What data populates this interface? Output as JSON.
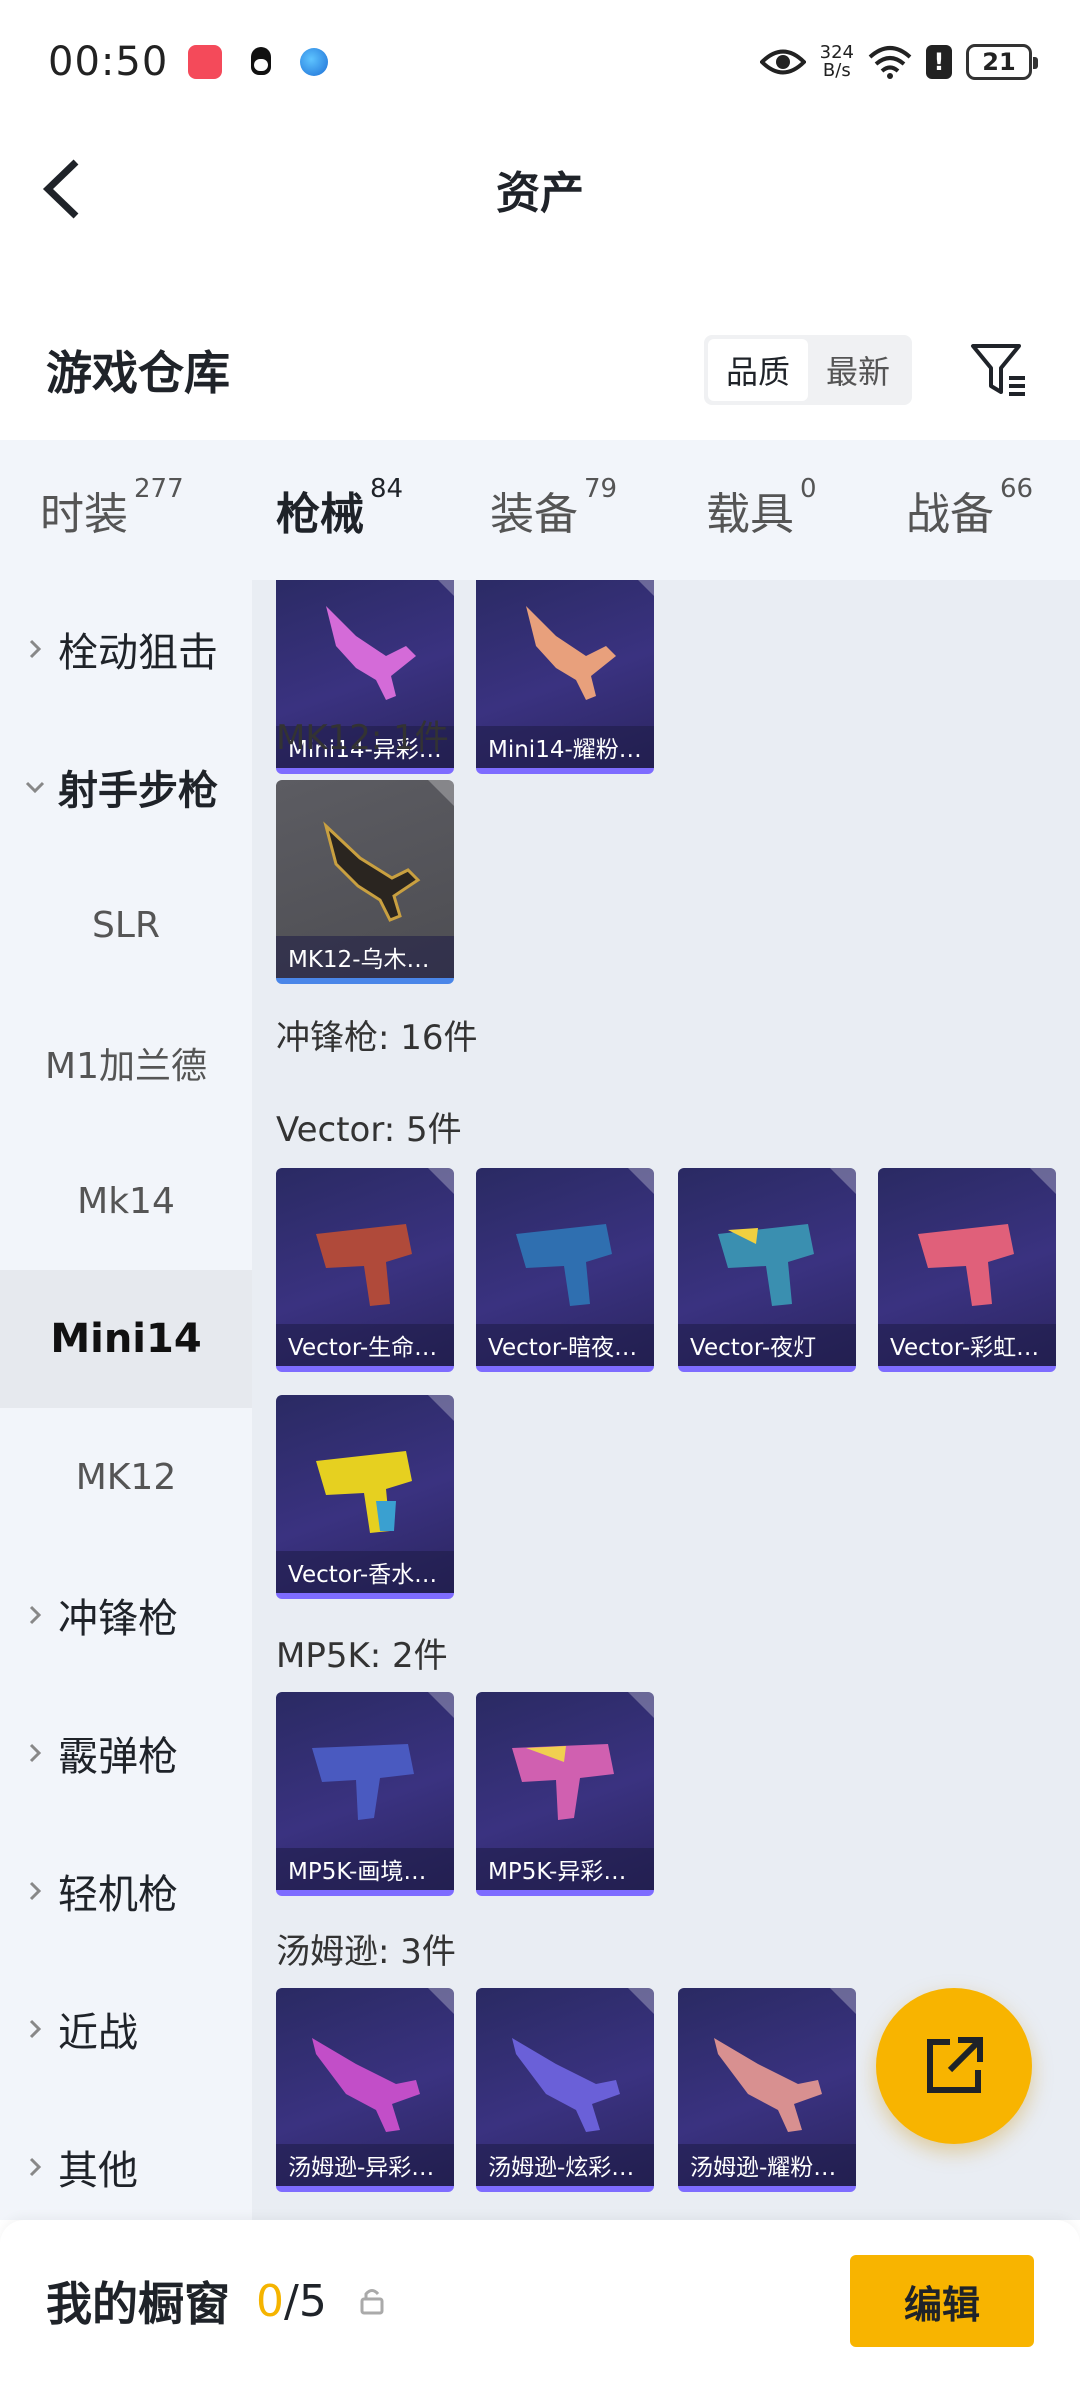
{
  "status_bar": {
    "time": "00:50",
    "net_speed_value": "324",
    "net_speed_unit": "B/s",
    "battery": "21",
    "icons": [
      "red-app-icon",
      "qq-icon",
      "globe-icon",
      "eye-icon",
      "wifi-icon",
      "alert-icon",
      "battery-icon"
    ]
  },
  "nav": {
    "title": "资产"
  },
  "header": {
    "title": "游戏仓库",
    "sort_options": [
      "品质",
      "最新"
    ],
    "active_sort": "品质"
  },
  "tabs": [
    {
      "label": "时装",
      "count": "277"
    },
    {
      "label": "枪械",
      "count": "84"
    },
    {
      "label": "装备",
      "count": "79"
    },
    {
      "label": "载具",
      "count": "0"
    },
    {
      "label": "战备",
      "count": "66"
    }
  ],
  "active_tab": "枪械",
  "sidebar": {
    "items": [
      {
        "label": "栓动狙击",
        "type": "group"
      },
      {
        "label": "射手步枪",
        "type": "group-open"
      },
      {
        "label": "SLR",
        "type": "sub"
      },
      {
        "label": "M1加兰德",
        "type": "sub"
      },
      {
        "label": "Mk14",
        "type": "sub"
      },
      {
        "label": "Mini14",
        "type": "sub-active"
      },
      {
        "label": "MK12",
        "type": "sub"
      },
      {
        "label": "冲锋枪",
        "type": "group"
      },
      {
        "label": "霰弹枪",
        "type": "group"
      },
      {
        "label": "轻机枪",
        "type": "group"
      },
      {
        "label": "近战",
        "type": "group"
      },
      {
        "label": "其他",
        "type": "group"
      }
    ]
  },
  "content": {
    "mini14_items": [
      "Mini14-异彩…",
      "Mini14-耀粉…"
    ],
    "mk12_title": "MK12: 1件",
    "mk12_items": [
      "MK12-乌木…"
    ],
    "smg_title": "冲锋枪: 16件",
    "vector_title": "Vector: 5件",
    "vector_items": [
      "Vector-生命…",
      "Vector-暗夜…",
      "Vector-夜灯",
      "Vector-彩虹…",
      "Vector-香水…"
    ],
    "mp5k_title": "MP5K: 2件",
    "mp5k_items": [
      "MP5K-画境…",
      "MP5K-异彩…"
    ],
    "thompson_title": "汤姆逊: 3件",
    "thompson_items": [
      "汤姆逊-异彩…",
      "汤姆逊-炫彩…",
      "汤姆逊-耀粉…"
    ]
  },
  "bottom_bar": {
    "title": "我的橱窗",
    "current": "0",
    "total": "/5",
    "edit_label": "编辑"
  },
  "colors": {
    "accent": "#f8b400",
    "card_purple": "#3a3280",
    "card_gray": "#55555a",
    "sidebar_bg": "#f2f5fa",
    "content_bg": "#e9edf3"
  }
}
